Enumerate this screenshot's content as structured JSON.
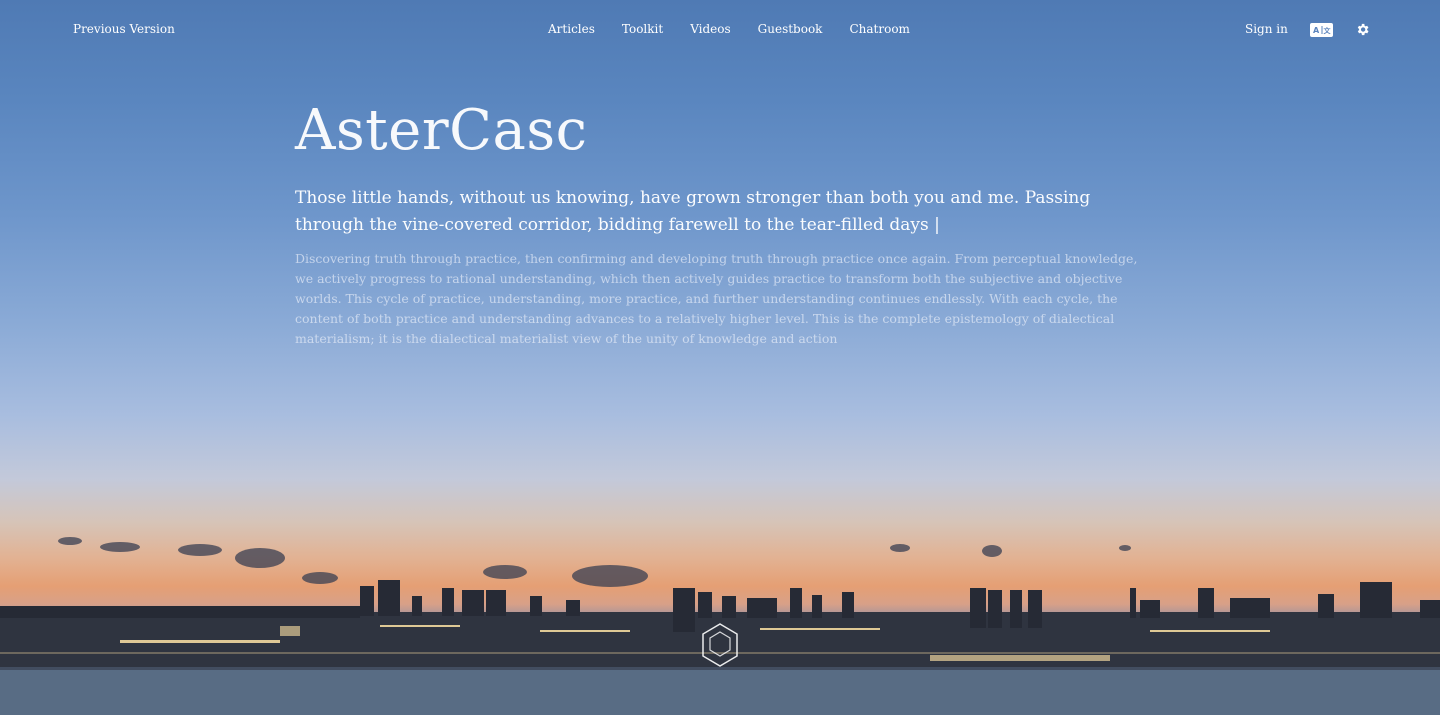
{
  "topbar": {
    "previous_version": "Previous Version",
    "nav": [
      "Articles",
      "Toolkit",
      "Videos",
      "Guestbook",
      "Chatroom"
    ],
    "sign_in": "Sign in",
    "translate_icon": "translate-icon",
    "settings_icon": "gear-icon"
  },
  "hero": {
    "title": "AsterCasc",
    "subtitle": "Those little hands, without us knowing, have grown stronger than both you and me. Passing through the vine-covered corridor, bidding farewell to the tear-filled days |",
    "quote": "Discovering truth through practice, then confirming and developing truth through practice once again. From perceptual knowledge, we actively progress to rational understanding, which then actively guides practice to transform both the subjective and objective worlds. This cycle of practice, understanding, more practice, and further understanding continues endlessly. With each cycle, the content of both practice and understanding advances to a relatively higher level. This is the complete epistemology of dialectical materialism; it is the dialectical materialist view of the unity of knowledge and action"
  },
  "colors": {
    "sky_top": "#4f7ab4",
    "sunset": "#e59f74",
    "water": "#5c7087"
  }
}
